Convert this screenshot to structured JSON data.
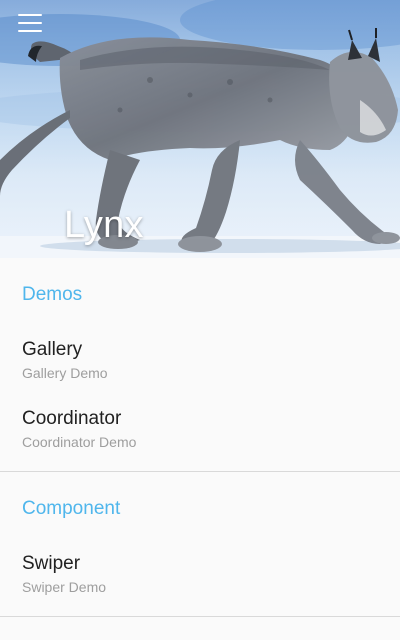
{
  "app": {
    "title": "Lynx"
  },
  "header": {
    "menu_icon": "hamburger-menu-icon",
    "image": "lynx-walking-in-snow"
  },
  "colors": {
    "section_accent": "#4fb6ec",
    "item_title": "#212121",
    "item_subtitle": "#9e9e9e"
  },
  "sections": [
    {
      "title": "Demos",
      "items": [
        {
          "title": "Gallery",
          "subtitle": "Gallery Demo"
        },
        {
          "title": "Coordinator",
          "subtitle": "Coordinator Demo"
        }
      ]
    },
    {
      "title": "Component",
      "items": [
        {
          "title": "Swiper",
          "subtitle": "Swiper Demo"
        }
      ]
    }
  ]
}
